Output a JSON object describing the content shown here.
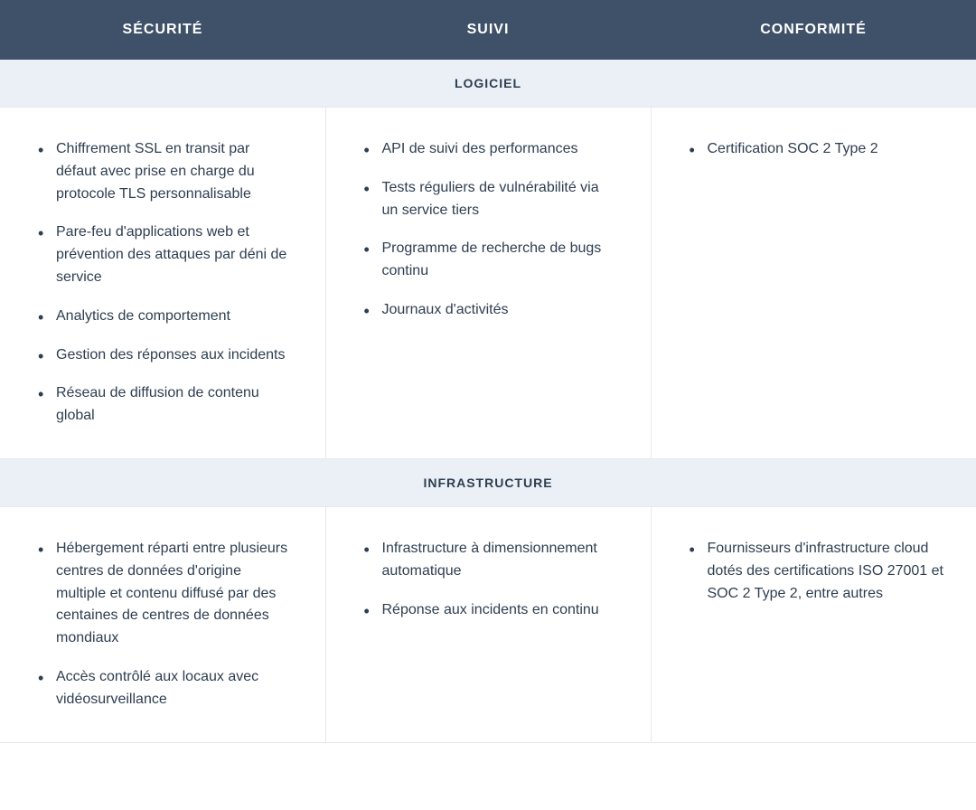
{
  "headers": {
    "col0": "SÉCURITÉ",
    "col1": "SUIVI",
    "col2": "CONFORMITÉ"
  },
  "sections": [
    {
      "title": "LOGICIEL",
      "cells": [
        [
          "Chiffrement SSL en transit par défaut avec prise en charge du protocole TLS personnalisable",
          "Pare-feu d'applications web et prévention des attaques par déni de service",
          "Analytics de comportement",
          "Gestion des réponses aux incidents",
          "Réseau de diffusion de contenu global"
        ],
        [
          "API de suivi des performances",
          "Tests réguliers de vulnérabilité via un service tiers",
          "Programme de recherche de bugs continu",
          "Journaux d'activités"
        ],
        [
          "Certification SOC 2 Type 2"
        ]
      ]
    },
    {
      "title": "INFRASTRUCTURE",
      "cells": [
        [
          "Hébergement réparti entre plusieurs centres de données d'origine multiple et contenu diffusé par des centaines de centres de données mondiaux",
          "Accès contrôlé aux locaux avec vidéosurveillance"
        ],
        [
          "Infrastructure à dimensionnement automatique",
          "Réponse aux incidents en continu"
        ],
        [
          "Fournisseurs d'infrastructure cloud dotés des certifications ISO 27001 et SOC 2 Type 2, entre autres"
        ]
      ]
    }
  ]
}
